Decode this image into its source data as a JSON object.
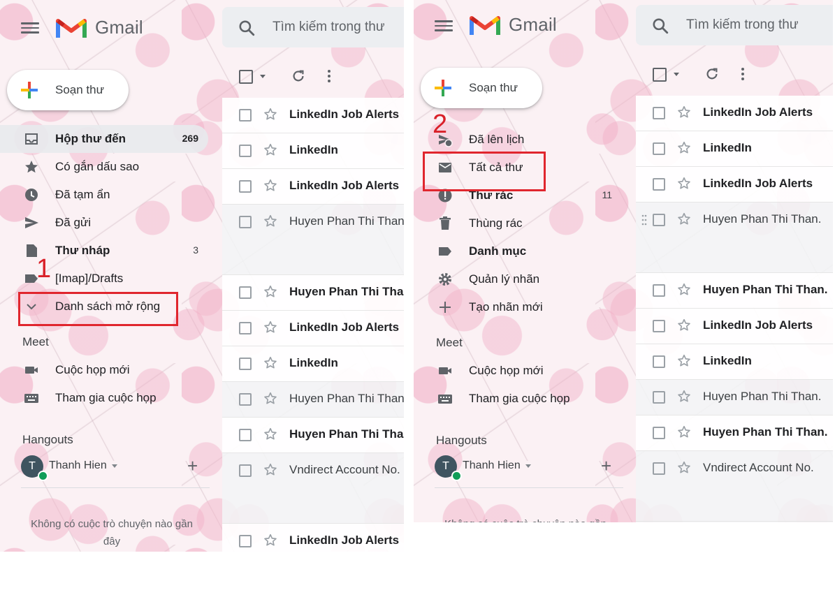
{
  "app": {
    "logo_text": "Gmail"
  },
  "search": {
    "placeholder": "Tìm kiếm trong thư"
  },
  "compose": {
    "label": "Soạn thư"
  },
  "panel1": {
    "nav": [
      {
        "label": "Hộp thư đến",
        "count": "269",
        "icon": "inbox-icon",
        "bold": true,
        "active": true
      },
      {
        "label": "Có gắn dấu sao",
        "count": "",
        "icon": "star-icon"
      },
      {
        "label": "Đã tạm ẩn",
        "count": "",
        "icon": "clock-icon"
      },
      {
        "label": "Đã gửi",
        "count": "",
        "icon": "send-icon"
      },
      {
        "label": "Thư nháp",
        "count": "3",
        "icon": "draft-icon",
        "bold": true
      },
      {
        "label": "[Imap]/Drafts",
        "count": "",
        "icon": "label-icon"
      },
      {
        "label": "Danh sách mở rộng",
        "count": "",
        "icon": "chevron-down-icon"
      }
    ],
    "step": "1",
    "rows": [
      {
        "sender": "LinkedIn Job Alerts",
        "unread": true
      },
      {
        "sender": "LinkedIn",
        "unread": true
      },
      {
        "sender": "LinkedIn Job Alerts",
        "unread": true
      },
      {
        "sender": "Huyen Phan Thi Thanh",
        "unread": false,
        "tall": true
      },
      {
        "sender": "Huyen Phan Thi Thanh",
        "unread": true
      },
      {
        "sender": "LinkedIn Job Alerts",
        "unread": true
      },
      {
        "sender": "LinkedIn",
        "unread": true
      },
      {
        "sender": "Huyen Phan Thi Thanh",
        "unread": false
      },
      {
        "sender": "Huyen Phan Thi Thanh",
        "unread": true
      },
      {
        "sender": "Vndirect Account No.",
        "unread": false,
        "tall": true
      },
      {
        "sender": "LinkedIn Job Alerts",
        "unread": true
      }
    ]
  },
  "panel2": {
    "nav": [
      {
        "label": "Đã lên lịch",
        "count": "",
        "icon": "scheduled-icon"
      },
      {
        "label": "Tất cả thư",
        "count": "",
        "icon": "mail-icon"
      },
      {
        "label": "Thư rác",
        "count": "11",
        "icon": "spam-icon",
        "bold": true
      },
      {
        "label": "Thùng rác",
        "count": "",
        "icon": "trash-icon"
      },
      {
        "label": "Danh mục",
        "count": "",
        "icon": "category-icon",
        "bold": true
      },
      {
        "label": "Quản lý nhãn",
        "count": "",
        "icon": "gear-icon"
      },
      {
        "label": "Tạo nhãn mới",
        "count": "",
        "icon": "plus-icon"
      }
    ],
    "step": "2",
    "rows": [
      {
        "sender": "LinkedIn Job Alerts",
        "unread": true
      },
      {
        "sender": "LinkedIn",
        "unread": true
      },
      {
        "sender": "LinkedIn Job Alerts",
        "unread": true
      },
      {
        "sender": "Huyen Phan Thi Than.",
        "unread": false,
        "tall": true,
        "grip": true
      },
      {
        "sender": "Huyen Phan Thi Than.",
        "unread": true
      },
      {
        "sender": "LinkedIn Job Alerts",
        "unread": true
      },
      {
        "sender": "LinkedIn",
        "unread": true
      },
      {
        "sender": "Huyen Phan Thi Than.",
        "unread": false
      },
      {
        "sender": "Huyen Phan Thi Than.",
        "unread": true
      },
      {
        "sender": "Vndirect Account No.",
        "unread": false,
        "tall": true
      },
      {
        "sender": "",
        "unread": false
      }
    ]
  },
  "meet": {
    "title": "Meet",
    "items": [
      {
        "label": "Cuộc họp mới",
        "icon": "video-icon"
      },
      {
        "label": "Tham gia cuộc họp",
        "icon": "keyboard-icon"
      }
    ]
  },
  "hangouts": {
    "title": "Hangouts",
    "user": "Thanh Hien",
    "avatar_letter": "T",
    "empty_text": "Không có cuộc trò chuyện nào gần đây"
  },
  "colors": {
    "highlight": "#e0262e",
    "online": "#0f9d58",
    "avatar": "#3f5460"
  }
}
